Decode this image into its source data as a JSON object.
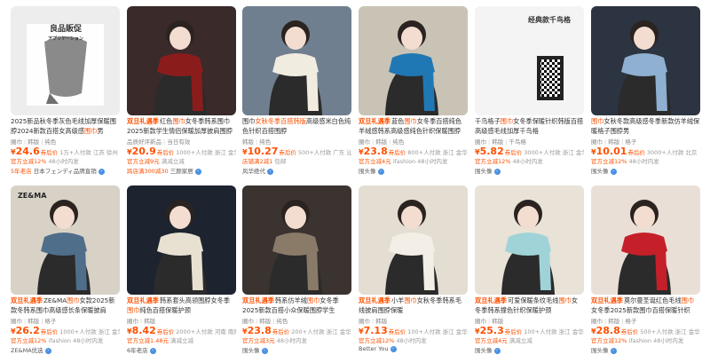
{
  "products": [
    {
      "tag": "",
      "title_pre": "2025新品秋冬季灰色毛线加厚保暖围脖2024新款百搭女高级感",
      "title_hl": "围巾",
      "title_post": "男",
      "attrs": [
        "圈巾",
        "韩版",
        "纯色"
      ],
      "price": "24.6",
      "price_label": "券后价",
      "sales": "1万+人付款 江苏 徐州",
      "promo": "官方立减12%",
      "promo_grey": "48小时内发",
      "shop": "日本フェンディ品牌直销",
      "shop_prefix": "5年老店",
      "img_text": [
        "良品販促",
        "アプリケーション"
      ],
      "colors": {
        "bg": "#ededed",
        "scarf": "#8a8a8a",
        "accent": "#6f6f6f"
      }
    },
    {
      "tag": "双旦礼遇季",
      "title_pre": "红色",
      "title_hl": "围巾",
      "title_post": "女冬季韩系围巾2025新款学生情侣保暖加厚披肩围脖",
      "attrs": [
        "品质好评新品",
        "当日有效"
      ],
      "price": "20.9",
      "price_label": "券后价",
      "sales": "1000+人付款 浙江 金华",
      "promo": "官方立减9元",
      "promo_grey": "满减立减",
      "shop": "三颜家居",
      "shop_prefix": "跨店满300减30",
      "img_text": [],
      "colors": {
        "bg": "#3a2a2a",
        "scarf": "#8b1c1c",
        "accent": "#2b5a3a"
      }
    },
    {
      "tag": "",
      "title_pre": "围巾",
      "title_hl": "女秋冬季百搭韩版",
      "title_post": "高级感米白色纯色针织百搭围脖",
      "attrs": [
        "韩版",
        "纯色"
      ],
      "price": "10.27",
      "price_label": "券后价",
      "sales": "500+人付款 广东 汕头",
      "promo": "店铺满2减1",
      "promo_grey": "包邮",
      "shop": "风华绝代",
      "shop_prefix": "",
      "img_text": [],
      "colors": {
        "bg": "#6f7f8f",
        "scarf": "#f1ece0",
        "accent": "#3a3a3a"
      }
    },
    {
      "tag": "双旦礼遇季",
      "title_pre": "蓝色",
      "title_hl": "围巾",
      "title_post": "女冬季百搭纯色羊绒感韩系高级感纯色针织保暖围脖",
      "attrs": [
        "圈巾",
        "韩版",
        "纯色"
      ],
      "price": "23.8",
      "price_label": "券后价",
      "sales": "800+人付款 浙江 金华",
      "promo": "官方立减4元",
      "promo_grey": "ifashion 48小时内发",
      "shop": "围头像",
      "shop_prefix": "",
      "img_text": [],
      "colors": {
        "bg": "#c9c3b5",
        "scarf": "#1f78b4",
        "accent": "#f1f1ef"
      }
    },
    {
      "tag": "",
      "title_pre": "千鸟格子",
      "title_hl": "围巾",
      "title_post": "女冬季保暖针织韩版百搭高级感毛线加厚千鸟格",
      "attrs": [
        "圈巾",
        "韩版",
        "千鸟格"
      ],
      "price": "5.82",
      "price_label": "券后价",
      "sales": "3000+人付款 浙江 金华",
      "promo": "官方立减12%",
      "promo_grey": "48小时内发",
      "shop": "围头像",
      "shop_prefix": "",
      "img_text": [
        "经典款千鸟格"
      ],
      "colors": {
        "bg": "#f4f4f4",
        "scarf": "#222222",
        "accent": "#ffffff"
      }
    },
    {
      "tag": "",
      "title_pre": "",
      "title_hl": "围巾",
      "title_post": "女秋冬款高级感冬季新款仿羊绒保暖格子围脖男",
      "attrs": [
        "圈巾",
        "韩版",
        "格子"
      ],
      "price": "10.01",
      "price_label": "券后价",
      "sales": "3000+人付款 北京",
      "promo": "官方立减12%",
      "promo_grey": "48小时内发",
      "shop": "围头像",
      "shop_prefix": "",
      "img_text": [],
      "colors": {
        "bg": "#2b3440",
        "scarf": "#8fb0d0",
        "accent": "#c94a2a"
      }
    },
    {
      "tag": "双旦礼遇季",
      "title_pre": "ZE&MA",
      "title_hl": "围巾",
      "title_post": "女款2025新款冬韩系围巾高级感长条保暖披肩",
      "attrs": [
        "圈巾",
        "韩版",
        "格子"
      ],
      "price": "26.2",
      "price_label": "券后价",
      "sales": "1000+人付款 浙江 金华",
      "promo": "官方立减12%",
      "promo_grey": "ifashion 48小时内发",
      "shop": "ZE&MA优选",
      "shop_prefix": "",
      "img_text": [
        "ZE&MA"
      ],
      "colors": {
        "bg": "#d8d2c6",
        "scarf": "#4f6e8a",
        "accent": "#c9c0b0"
      }
    },
    {
      "tag": "双旦礼遇季",
      "title_pre": "韩系套头高领围脖女冬季",
      "title_hl": "围巾",
      "title_post": "纯色百搭保暖护颈",
      "attrs": [
        "圈巾",
        "韩版"
      ],
      "price": "8.42",
      "price_label": "券后价",
      "sales": "2000+人付款 河南 南阳",
      "promo": "官方立减1.48元",
      "promo_grey": "满减立减",
      "shop": "6年老店",
      "shop_prefix": "",
      "img_text": [],
      "colors": {
        "bg": "#1d2430",
        "scarf": "#e8e1d2",
        "accent": "#3a3a3a"
      }
    },
    {
      "tag": "双旦礼遇季",
      "title_pre": "韩系仿羊绒",
      "title_hl": "围巾",
      "title_post": "女冬季2025新款百搭小众保暖围脖学生",
      "attrs": [
        "圈巾",
        "韩版",
        "纯色"
      ],
      "price": "23.8",
      "price_label": "券后价",
      "sales": "200+人付款 浙江 金华",
      "promo": "官方立减3元",
      "promo_grey": "48小时内发",
      "shop": "围头像",
      "shop_prefix": "",
      "img_text": [],
      "colors": {
        "bg": "#3a3330",
        "scarf": "#8a7a68",
        "accent": "#1f1b1a"
      }
    },
    {
      "tag": "双旦礼遇季",
      "title_pre": "小羊",
      "title_hl": "围巾",
      "title_post": "女秋冬季韩系毛线披肩围脖保暖",
      "attrs": [
        "圈巾",
        "韩版"
      ],
      "price": "7.13",
      "price_label": "券后价",
      "sales": "100+人付款 浙江 金华",
      "promo": "官方立减12%",
      "promo_grey": "48小时内发",
      "shop": "Better You",
      "shop_prefix": "",
      "img_text": [],
      "colors": {
        "bg": "#e4ddd2",
        "scarf": "#f4efe6",
        "accent": "#5a4a3a"
      }
    },
    {
      "tag": "双旦礼遇季",
      "title_pre": "可爱保暖条纹毛线",
      "title_hl": "围巾",
      "title_post": "女冬季韩系撞色针织保暖护颈",
      "attrs": [
        "圈巾",
        "韩版"
      ],
      "price": "25.3",
      "price_label": "券后价",
      "sales": "100+人付款 浙江 金华",
      "promo": "官方立减4元",
      "promo_grey": "满减立减",
      "shop": "围头像",
      "shop_prefix": "",
      "img_text": [],
      "colors": {
        "bg": "#e9e2d6",
        "scarf": "#9fd3d8",
        "accent": "#f1efe8"
      }
    },
    {
      "tag": "双旦礼遇季",
      "title_pre": "莫尔曼圣诞红色毛线",
      "title_hl": "围巾",
      "title_post": "女冬季2025新款围巾百搭保暖针织",
      "attrs": [
        "圈巾",
        "韩版",
        "格子"
      ],
      "price": "28.8",
      "price_label": "券后价",
      "sales": "500+人付款 浙江 金华",
      "promo": "官方立减12%",
      "promo_grey": "ifashion 48小时内发",
      "shop": "围头像",
      "shop_prefix": "",
      "img_text": [],
      "colors": {
        "bg": "#eadfd6",
        "scarf": "#c51f2a",
        "accent": "#f5f2ee"
      }
    }
  ]
}
